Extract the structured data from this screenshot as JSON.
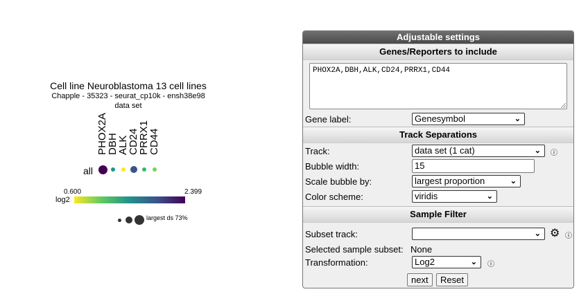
{
  "plot": {
    "title": "Cell line Neuroblastoma 13 cell lines",
    "subtitle": "Chapple - 35323 - seurat_cp10k - ensh38e98",
    "subtitle2": "data set",
    "genes": [
      "PHOX2A",
      "DBH",
      "ALK",
      "CD24",
      "PRRX1",
      "CD44"
    ],
    "row_label": "all",
    "bubbles": [
      {
        "gene": "PHOX2A",
        "color": "#440154",
        "size_rank": 5
      },
      {
        "gene": "DBH",
        "color": "#21918c",
        "size_rank": 2
      },
      {
        "gene": "ALK",
        "color": "#fde725",
        "size_rank": 1
      },
      {
        "gene": "CD24",
        "color": "#3b528b",
        "size_rank": 4
      },
      {
        "gene": "PRRX1",
        "color": "#35b779",
        "size_rank": 2
      },
      {
        "gene": "CD44",
        "color": "#7ad151",
        "size_rank": 2
      }
    ],
    "legend": {
      "min": "0.600",
      "max": "2.399",
      "unit": "log2",
      "size_label": "largest ds 73%"
    }
  },
  "panel": {
    "title": "Adjustable settings",
    "genes_section": "Genes/Reporters to include",
    "genes_value": "PHOX2A,DBH,ALK,CD24,PRRX1,CD44",
    "gene_label": "Gene label:",
    "gene_label_value": "Genesymbol",
    "track_section": "Track Separations",
    "track_label": "Track:",
    "track_value": "data set (1 cat)",
    "bubble_width_label": "Bubble width:",
    "bubble_width_value": "15",
    "scale_label": "Scale bubble by:",
    "scale_value": "largest proportion",
    "color_label": "Color scheme:",
    "color_value": "viridis",
    "sample_section": "Sample Filter",
    "subset_label": "Subset track:",
    "subset_value": "",
    "selected_label": "Selected sample subset:",
    "selected_value": "None",
    "transform_label": "Transformation:",
    "transform_value": "Log2",
    "next_label": "next",
    "reset_label": "Reset",
    "info_glyph": "ⓘ",
    "gear_glyph": "⚙",
    "chevron_glyph": "⌄"
  }
}
